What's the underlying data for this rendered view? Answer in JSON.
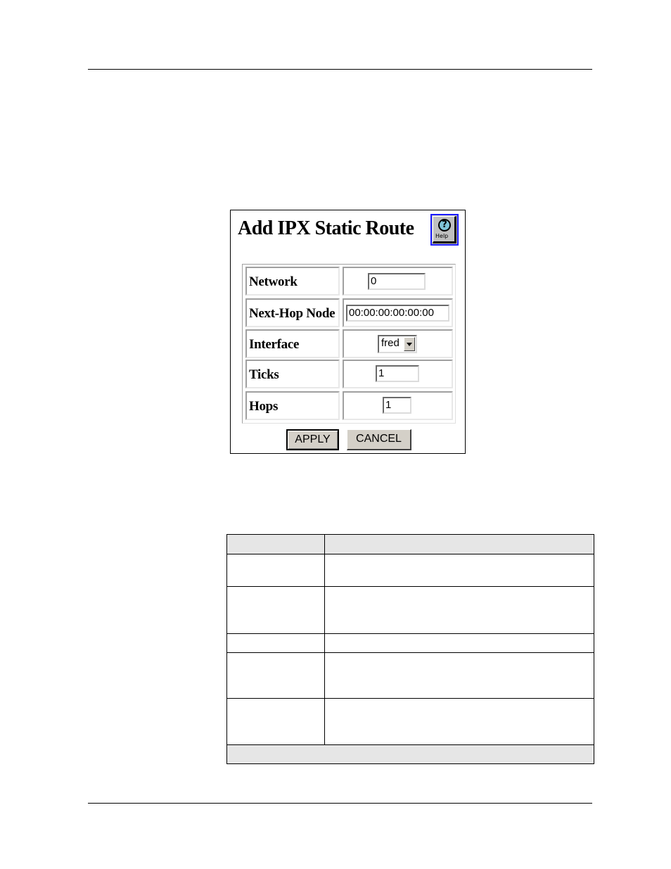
{
  "panel": {
    "title": "Add IPX Static Route",
    "help_button": {
      "icon": "help-icon",
      "label": "Help",
      "glyph": "?"
    },
    "fields": [
      {
        "label": "Network",
        "type": "text",
        "value": "0"
      },
      {
        "label": "Next-Hop Node",
        "type": "text",
        "value": "00:00:00:00:00:00"
      },
      {
        "label": "Interface",
        "type": "select",
        "value": "fred"
      },
      {
        "label": "Ticks",
        "type": "text",
        "value": "1"
      },
      {
        "label": "Hops",
        "type": "text",
        "value": "1"
      }
    ],
    "buttons": {
      "apply": "APPLY",
      "cancel": "CANCEL"
    }
  },
  "description_table": {
    "header": [
      "",
      ""
    ],
    "rows": [
      [
        "",
        ""
      ],
      [
        "",
        ""
      ],
      [
        "",
        ""
      ],
      [
        "",
        ""
      ],
      [
        "",
        ""
      ]
    ],
    "footer": ""
  },
  "colors": {
    "help_border": "#1a1aff",
    "table_shade": "#e6e6e6",
    "button_face": "#d4d0c8"
  }
}
